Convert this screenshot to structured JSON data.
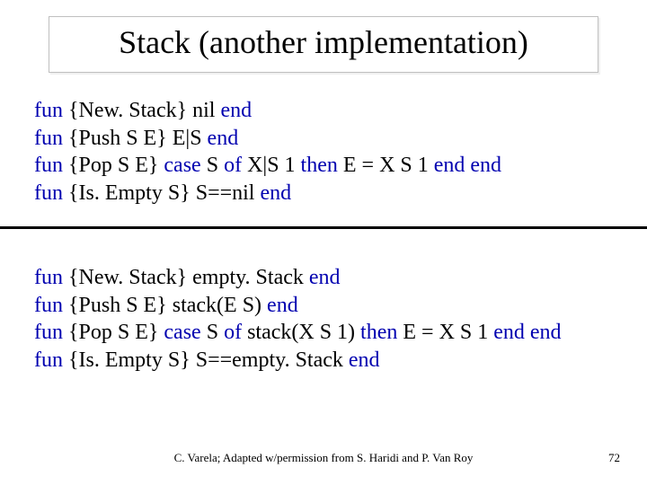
{
  "title": "Stack (another implementation)",
  "kw": {
    "fun": "fun",
    "case": "case",
    "of": "of",
    "then": "then",
    "end": "end"
  },
  "block1": {
    "l1": {
      "body": "{New. Stack} nil "
    },
    "l2": {
      "body": "{Push S E} E|S "
    },
    "l3": {
      "mid1": " {Pop S E} ",
      "mid2": " S ",
      "mid3": "  X|S 1 ",
      "mid4": " E = X  S 1 "
    },
    "l4": {
      "body": "{Is. Empty S} S==nil "
    }
  },
  "block2": {
    "l1": {
      "body": "{New. Stack} empty. Stack "
    },
    "l2": {
      "body": "{Push S E} stack(E S) "
    },
    "l3": {
      "mid1": " {Pop S E} ",
      "mid2": " S ",
      "mid3": " stack(X S 1) ",
      "mid4": " E = X S 1 "
    },
    "l4": {
      "body": "{Is. Empty S} S==empty. Stack "
    }
  },
  "footer": {
    "credit": "C. Varela; Adapted w/permission from S. Haridi and P. Van Roy",
    "page": "72"
  }
}
